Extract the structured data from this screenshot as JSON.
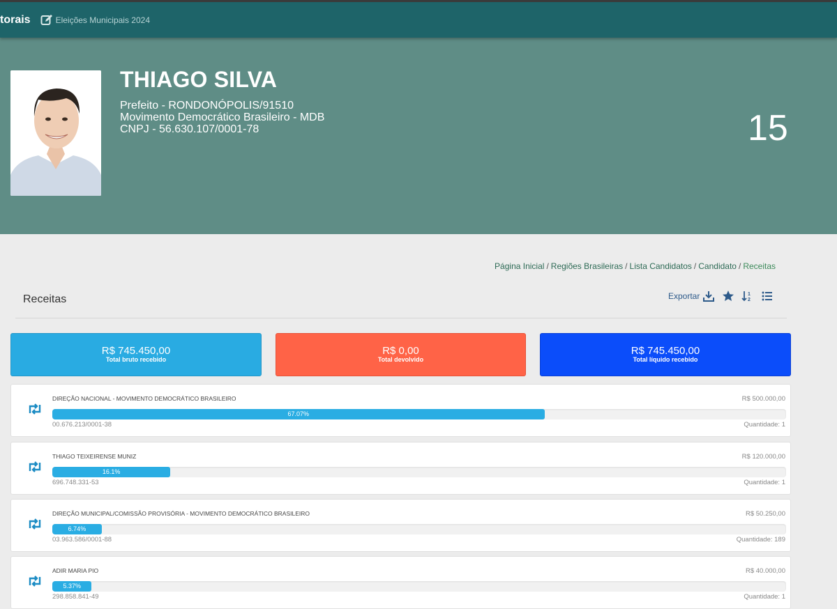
{
  "topbar": {
    "brand": "torais",
    "subtitle": "Eleições Municipais 2024"
  },
  "candidate": {
    "name": "THIAGO SILVA",
    "office": "Prefeito - RONDONÓPOLIS/91510",
    "party": "Movimento Democrático Brasileiro - MDB",
    "cnpj": "CNPJ - 56.630.107/0001-78",
    "number": "15"
  },
  "breadcrumb": {
    "items": [
      "Página Inicial",
      "Regiões Brasileiras",
      "Lista Candidatos",
      "Candidato"
    ],
    "current": "Receitas",
    "separator": "/"
  },
  "section": {
    "title": "Receitas",
    "export_label": "Exportar"
  },
  "summary": [
    {
      "amount": "R$ 745.450,00",
      "label": "Total bruto recebido",
      "color": "#29abe2"
    },
    {
      "amount": "R$ 0,00",
      "label": "Total devolvido",
      "color": "#ff6347"
    },
    {
      "amount": "R$ 745.450,00",
      "label": "Total líquido recebido",
      "color": "#0b4dfa"
    }
  ],
  "receipts": [
    {
      "donor": "DIREÇÃO NACIONAL - MOVIMENTO DEMOCRÁTICO BRASILEIRO",
      "value": "R$ 500.000,00",
      "percent_label": "67.07%",
      "percent": 67.07,
      "doc": "00.676.213/0001-38",
      "qty": "Quantidade: 1"
    },
    {
      "donor": "THIAGO TEIXEIRENSE MUNIZ",
      "value": "R$ 120.000,00",
      "percent_label": "16.1%",
      "percent": 16.1,
      "doc": "696.748.331-53",
      "qty": "Quantidade: 1"
    },
    {
      "donor": "DIREÇÃO MUNICIPAL/COMISSÃO PROVISÓRIA - MOVIMENTO DEMOCRÁTICO BRASILEIRO",
      "value": "R$ 50.250,00",
      "percent_label": "6.74%",
      "percent": 6.74,
      "doc": "03.963.586/0001-88",
      "qty": "Quantidade: 189"
    },
    {
      "donor": "ADIR MARIA PIO",
      "value": "R$ 40.000,00",
      "percent_label": "5.37%",
      "percent": 5.37,
      "doc": "298.858.841-49",
      "qty": "Quantidade: 1"
    }
  ],
  "colors": {
    "topbar": "#1e6469",
    "hero": "#5f8d86",
    "progress": "#2aade3"
  }
}
